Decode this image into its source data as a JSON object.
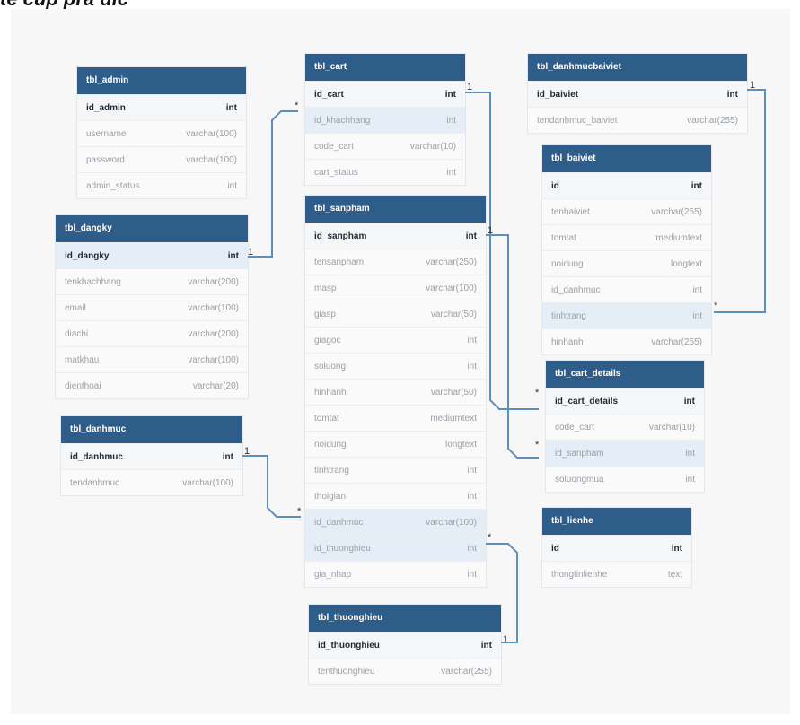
{
  "caption": "te cup pra dic",
  "tables": {
    "admin": {
      "name": "tbl_admin",
      "rows": [
        {
          "col": "id_admin",
          "type": "int"
        },
        {
          "col": "username",
          "type": "varchar(100)"
        },
        {
          "col": "password",
          "type": "varchar(100)"
        },
        {
          "col": "admin_status",
          "type": "int"
        }
      ]
    },
    "cart": {
      "name": "tbl_cart",
      "rows": [
        {
          "col": "id_cart",
          "type": "int"
        },
        {
          "col": "id_khachhang",
          "type": "int"
        },
        {
          "col": "code_cart",
          "type": "varchar(10)"
        },
        {
          "col": "cart_status",
          "type": "int"
        }
      ]
    },
    "danhmucbaiviet": {
      "name": "tbl_danhmucbaiviet",
      "rows": [
        {
          "col": "id_baiviet",
          "type": "int"
        },
        {
          "col": "tendanhmuc_baiviet",
          "type": "varchar(255)"
        }
      ]
    },
    "baiviet": {
      "name": "tbl_baiviet",
      "rows": [
        {
          "col": "id",
          "type": "int"
        },
        {
          "col": "tenbaiviet",
          "type": "varchar(255)"
        },
        {
          "col": "tomtat",
          "type": "mediumtext"
        },
        {
          "col": "noidung",
          "type": "longtext"
        },
        {
          "col": "id_danhmuc",
          "type": "int"
        },
        {
          "col": "tinhtrang",
          "type": "int"
        },
        {
          "col": "hinhanh",
          "type": "varchar(255)"
        }
      ]
    },
    "dangky": {
      "name": "tbl_dangky",
      "rows": [
        {
          "col": "id_dangky",
          "type": "int"
        },
        {
          "col": "tenkhachhang",
          "type": "varchar(200)"
        },
        {
          "col": "email",
          "type": "varchar(100)"
        },
        {
          "col": "diachi",
          "type": "varchar(200)"
        },
        {
          "col": "matkhau",
          "type": "varchar(100)"
        },
        {
          "col": "dienthoai",
          "type": "varchar(20)"
        }
      ]
    },
    "sanpham": {
      "name": "tbl_sanpham",
      "rows": [
        {
          "col": "id_sanpham",
          "type": "int"
        },
        {
          "col": "tensanpham",
          "type": "varchar(250)"
        },
        {
          "col": "masp",
          "type": "varchar(100)"
        },
        {
          "col": "giasp",
          "type": "varchar(50)"
        },
        {
          "col": "giagoc",
          "type": "int"
        },
        {
          "col": "soluong",
          "type": "int"
        },
        {
          "col": "hinhanh",
          "type": "varchar(50)"
        },
        {
          "col": "tomtat",
          "type": "mediumtext"
        },
        {
          "col": "noidung",
          "type": "longtext"
        },
        {
          "col": "tinhtrang",
          "type": "int"
        },
        {
          "col": "thoigian",
          "type": "int"
        },
        {
          "col": "id_danhmuc",
          "type": "varchar(100)"
        },
        {
          "col": "id_thuonghieu",
          "type": "int"
        },
        {
          "col": "gia_nhap",
          "type": "int"
        }
      ]
    },
    "cart_details": {
      "name": "tbl_cart_details",
      "rows": [
        {
          "col": "id_cart_details",
          "type": "int"
        },
        {
          "col": "code_cart",
          "type": "varchar(10)"
        },
        {
          "col": "id_sanpham",
          "type": "int"
        },
        {
          "col": "soluongmua",
          "type": "int"
        }
      ]
    },
    "danhmuc": {
      "name": "tbl_danhmuc",
      "rows": [
        {
          "col": "id_danhmuc",
          "type": "int"
        },
        {
          "col": "tendanhmuc",
          "type": "varchar(100)"
        }
      ]
    },
    "lienhe": {
      "name": "tbl_lienhe",
      "rows": [
        {
          "col": "id",
          "type": "int"
        },
        {
          "col": "thongtinlienhe",
          "type": "text"
        }
      ]
    },
    "thuonghieu": {
      "name": "tbl_thuonghieu",
      "rows": [
        {
          "col": "id_thuonghieu",
          "type": "int"
        },
        {
          "col": "tenthuonghieu",
          "type": "varchar(255)"
        }
      ]
    }
  },
  "relations": {
    "one": "1",
    "many": "*"
  },
  "colors": {
    "header": "#2f5d8a",
    "connector": "#5b8fc0",
    "highlight": "#e5eef6"
  }
}
